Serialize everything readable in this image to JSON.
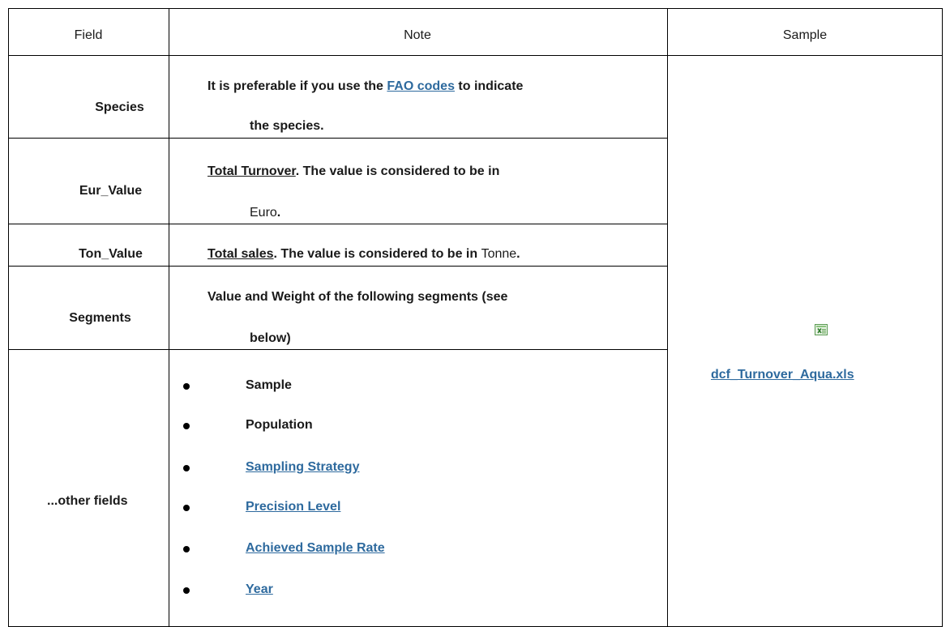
{
  "header": {
    "field": "Field",
    "note": "Note",
    "sample": "Sample"
  },
  "rows": [
    {
      "field": "Species",
      "note_pre": "It is preferable if you use the ",
      "note_link": "FAO codes",
      "note_post": " to indicate",
      "note_line2": "the species."
    },
    {
      "field": "Eur_Value",
      "note_link": "Total Turnover",
      "note_post": ". The value is considered to be in",
      "note_line2_normal": "Euro",
      "note_line2_end": "."
    },
    {
      "field": "Ton_Value",
      "note_link": "Total sales",
      "note_post": ". The value is considered to be in ",
      "note_unit": "Tonne",
      "note_end": "."
    },
    {
      "field": "Segments",
      "note_line1": "Value and Weight of the following segments (see",
      "note_line2": "below)"
    },
    {
      "field": "...other fields",
      "items": [
        {
          "label": "Sample",
          "link": false
        },
        {
          "label": "Population",
          "link": false
        },
        {
          "label": "Sampling Strategy",
          "link": true
        },
        {
          "label": "Precision Level",
          "link": true
        },
        {
          "label": "Achieved Sample Rate",
          "link": true
        },
        {
          "label": "Year",
          "link": true
        }
      ]
    }
  ],
  "sample_file": {
    "icon": "excel-file-icon",
    "name": "dcf_Turnover_Aqua.xls"
  },
  "colors": {
    "link": "#2e6a9e",
    "border": "#000000"
  }
}
